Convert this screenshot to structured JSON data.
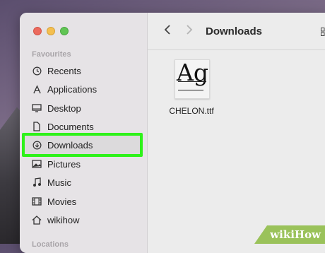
{
  "sidebar": {
    "section_favourites": "Favourites",
    "items": [
      {
        "label": "Recents",
        "icon": "clock-icon"
      },
      {
        "label": "Applications",
        "icon": "applications-icon"
      },
      {
        "label": "Desktop",
        "icon": "desktop-icon"
      },
      {
        "label": "Documents",
        "icon": "document-icon"
      },
      {
        "label": "Downloads",
        "icon": "download-icon",
        "selected": true
      },
      {
        "label": "Pictures",
        "icon": "picture-icon"
      },
      {
        "label": "Music",
        "icon": "music-icon"
      },
      {
        "label": "Movies",
        "icon": "film-icon"
      },
      {
        "label": "wikihow",
        "icon": "home-icon"
      }
    ],
    "section_locations": "Locations"
  },
  "toolbar": {
    "title": "Downloads"
  },
  "files": [
    {
      "name": "CHELON.ttf",
      "preview_text": "Ag"
    }
  ],
  "watermark": {
    "text_1": "wiki",
    "text_2": "How"
  },
  "colors": {
    "highlight": "#2ef21a",
    "watermark": "#9ac25a"
  }
}
